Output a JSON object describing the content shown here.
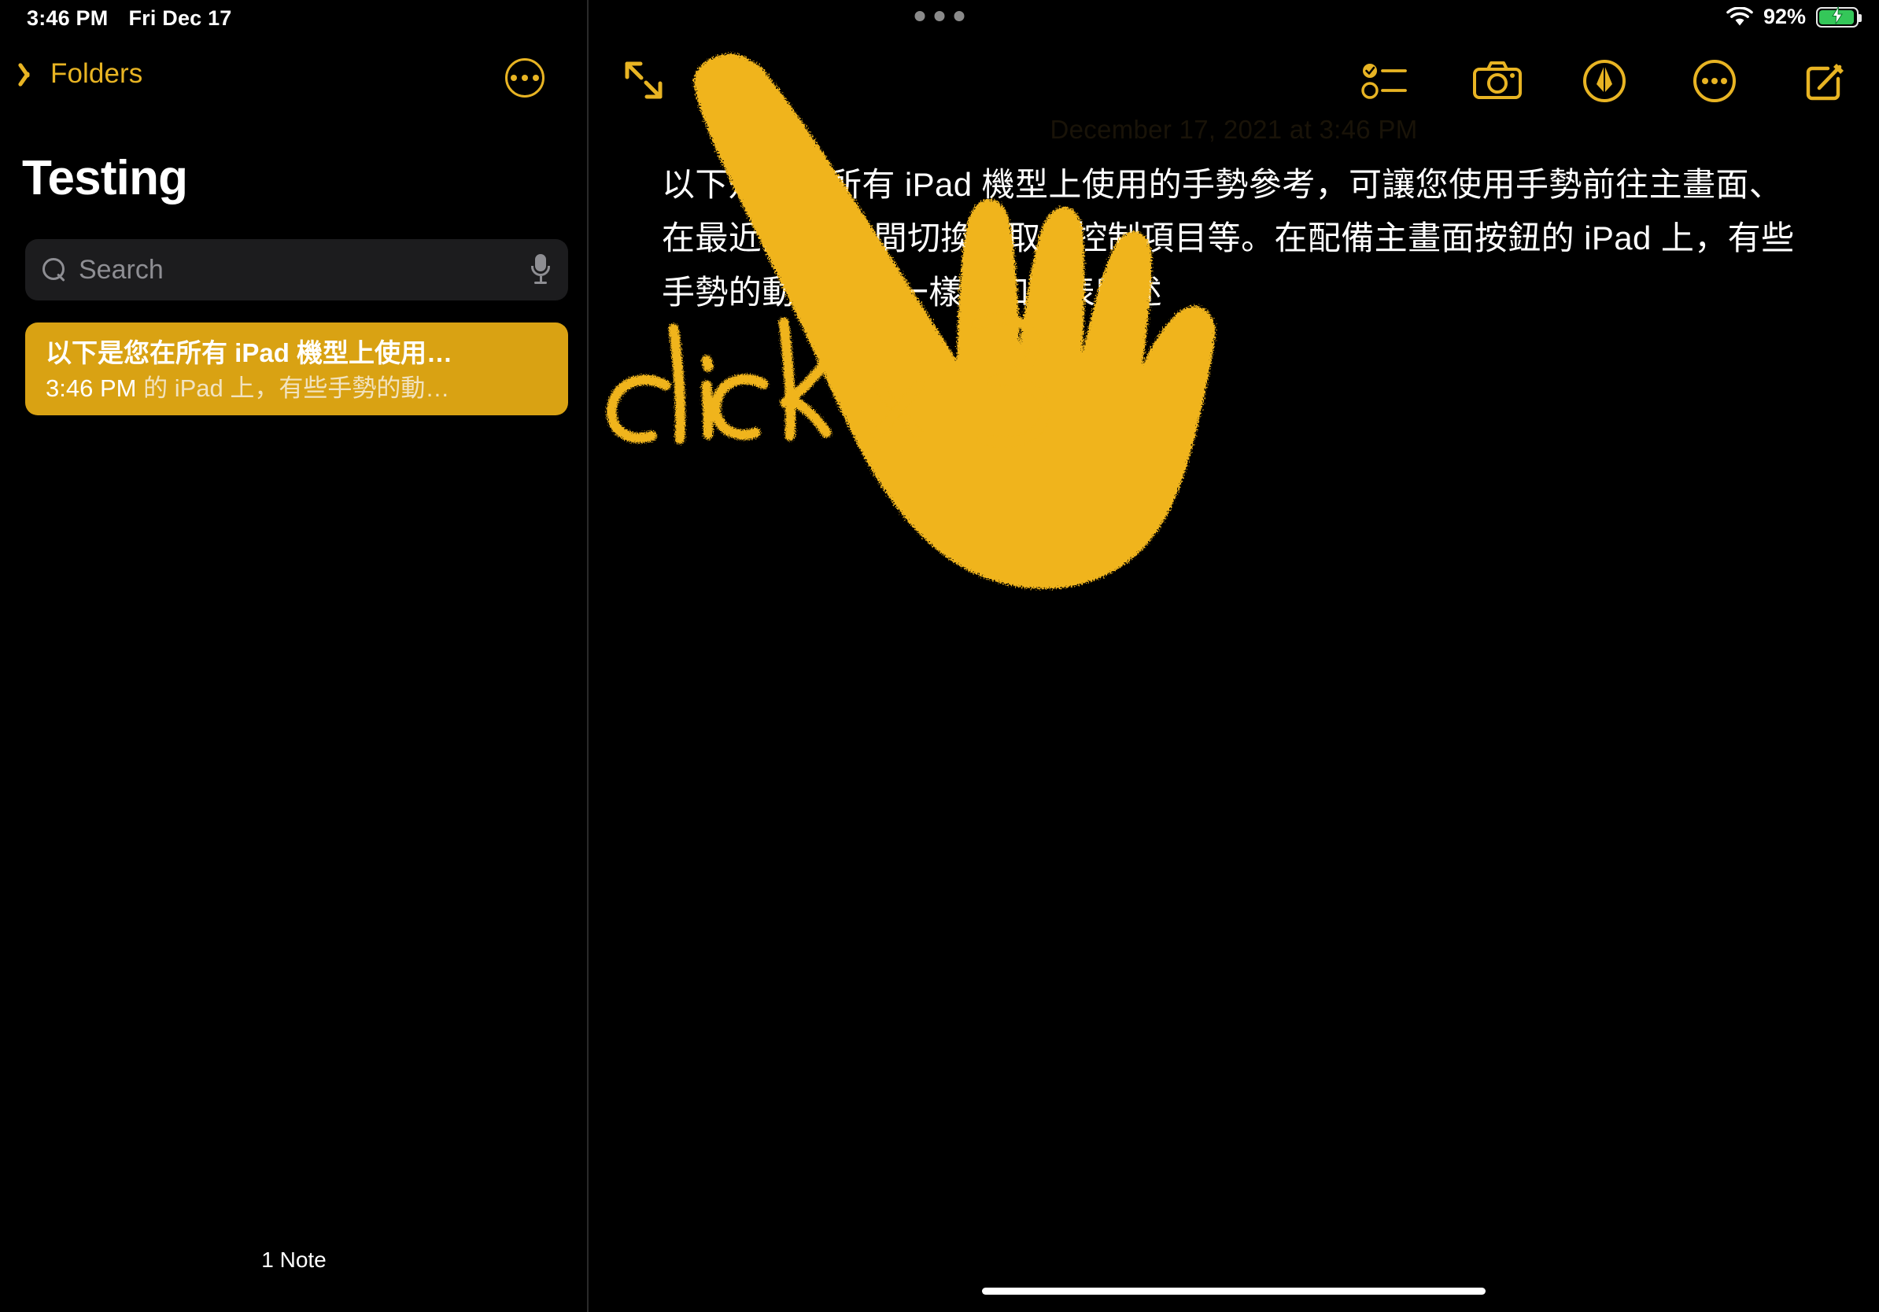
{
  "status_bar": {
    "time": "3:46 PM",
    "date": "Fri Dec 17",
    "battery_percent": "92%",
    "wifi_icon": "wifi-icon",
    "battery_icon": "battery-charging-icon",
    "multitask_icon": "multitasking-dots-icon"
  },
  "sidebar": {
    "back_label": "Folders",
    "back_icon": "chevron-left-icon",
    "more_icon": "more-circle-icon",
    "title": "Testing",
    "search": {
      "placeholder": "Search",
      "value": "",
      "search_icon": "search-icon",
      "mic_icon": "microphone-icon"
    },
    "notes": [
      {
        "title": "以下是您在所有 iPad 機型上使用…",
        "time": "3:46 PM",
        "preview": "的 iPad 上，有些手勢的動…",
        "selected": true
      }
    ],
    "note_count": "1 Note"
  },
  "detail": {
    "expand_icon": "expand-arrows-icon",
    "toolbar": [
      {
        "name": "checklist-button",
        "icon": "checklist-icon"
      },
      {
        "name": "camera-button",
        "icon": "camera-icon"
      },
      {
        "name": "markup-button",
        "icon": "pen-markup-icon"
      },
      {
        "name": "more-button",
        "icon": "more-circle-icon"
      },
      {
        "name": "compose-button",
        "icon": "compose-icon"
      }
    ],
    "note_date": "December 17, 2021 at 3:46 PM",
    "body_lines": [
      "以下是您在所有 iPad 機型上使用的手勢參考，可讓您使用手勢前往主畫面、",
      "在最近的 App 間切換、取用控制項目等。在配備主畫面按鈕的 iPad 上，有些",
      "手勢的動作並不一樣，如下表所述"
    ],
    "handwriting": "click x 3",
    "drawing_description": "hand-pointing-drawing",
    "home_indicator": "home-indicator"
  },
  "colors": {
    "accent": "#e8b423",
    "note_cell": "#d9a213",
    "background": "#000000",
    "search_field": "#1c1c1e",
    "battery_green": "#34c759",
    "ink": "#f0b41a"
  }
}
